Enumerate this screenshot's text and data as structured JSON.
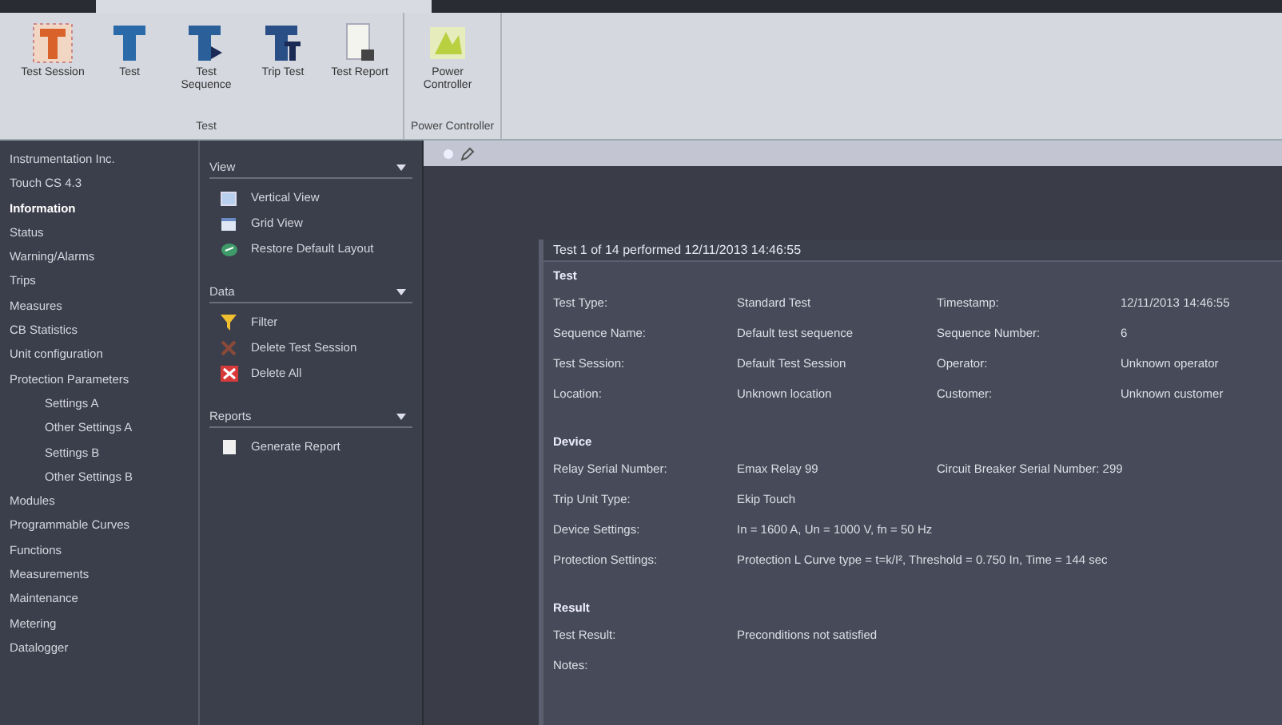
{
  "ribbon": {
    "groups": [
      {
        "label": "Test",
        "buttons": [
          {
            "label": "Test Session",
            "kind": "session"
          },
          {
            "label": "Test",
            "kind": "test"
          },
          {
            "label": "Test Sequence",
            "kind": "sequence"
          },
          {
            "label": "Trip Test",
            "kind": "trip"
          },
          {
            "label": "Test Report",
            "kind": "report"
          }
        ]
      },
      {
        "label": "Power Controller",
        "buttons": [
          {
            "label": "Power Controller",
            "kind": "power"
          }
        ]
      }
    ]
  },
  "tree": {
    "items": [
      {
        "label": "Instrumentation Inc.",
        "selected": false
      },
      {
        "label": "Touch CS 4.3",
        "selected": false
      },
      {
        "label": "Information",
        "selected": true
      },
      {
        "label": "Status",
        "selected": false
      },
      {
        "label": "Warning/Alarms",
        "selected": false
      },
      {
        "label": "Trips",
        "selected": false
      },
      {
        "label": "Measures",
        "selected": false
      },
      {
        "label": "CB Statistics",
        "selected": false
      },
      {
        "label": "Unit configuration",
        "selected": false
      },
      {
        "label": "Protection Parameters",
        "selected": false,
        "children": [
          {
            "label": "Settings A",
            "selected": false
          },
          {
            "label": "Other Settings A",
            "selected": false
          },
          {
            "label": "Settings B",
            "selected": false
          },
          {
            "label": "Other Settings B",
            "selected": false
          }
        ]
      },
      {
        "label": "Modules",
        "selected": false
      },
      {
        "label": "Programmable Curves",
        "selected": false
      },
      {
        "label": "Functions",
        "selected": false
      },
      {
        "label": "Measurements",
        "selected": false
      },
      {
        "label": "Maintenance",
        "selected": false
      },
      {
        "label": "Metering",
        "selected": false
      },
      {
        "label": "Datalogger",
        "selected": false
      }
    ]
  },
  "actions": {
    "sections": [
      {
        "title": "View",
        "items": [
          {
            "label": "Vertical View",
            "kind": "vertical"
          },
          {
            "label": "Grid View",
            "kind": "grid"
          },
          {
            "label": "Restore Default Layout",
            "kind": "restore"
          }
        ]
      },
      {
        "title": "Data",
        "items": [
          {
            "label": "Filter",
            "kind": "filter"
          },
          {
            "label": "Delete Test Session",
            "kind": "delete-session"
          },
          {
            "label": "Delete All",
            "kind": "delete-all"
          }
        ]
      },
      {
        "title": "Reports",
        "items": [
          {
            "label": "Generate Report",
            "kind": "generate"
          }
        ]
      }
    ]
  },
  "report": {
    "title": "Test 1 of 14 performed 12/11/2013 14:46:55",
    "sections": [
      {
        "heading": "Test",
        "rows": [
          {
            "cells": [
              "Test Type:",
              "Standard Test",
              "Timestamp:",
              "12/11/2013 14:46:55"
            ]
          },
          {
            "cells": [
              "Sequence Name:",
              "Default test sequence",
              "Sequence Number:",
              "6"
            ]
          },
          {
            "cells": [
              "Test Session:",
              "Default Test Session",
              "Operator:",
              "Unknown operator"
            ]
          },
          {
            "cells": [
              "Location:",
              "Unknown location",
              "Customer:",
              "Unknown customer"
            ]
          }
        ]
      },
      {
        "heading": "Device",
        "rows": [
          {
            "cells": [
              "Relay Serial Number:",
              "Emax Relay 99",
              "Circuit Breaker Serial Number: 299"
            ]
          },
          {
            "cells": [
              "Trip Unit Type:",
              "Ekip Touch"
            ]
          },
          {
            "cells": [
              "Device Settings:",
              "In = 1600 A, Un = 1000 V, fn = 50 Hz"
            ]
          },
          {
            "cells": [
              "Protection Settings:",
              "Protection L Curve type = t=k/I², Threshold = 0.750 In, Time = 144 sec"
            ]
          }
        ]
      },
      {
        "heading": "Result",
        "rows": [
          {
            "cells": [
              "Test Result:",
              "Preconditions not satisfied"
            ]
          },
          {
            "cells": [
              "Notes:"
            ]
          }
        ]
      }
    ]
  }
}
